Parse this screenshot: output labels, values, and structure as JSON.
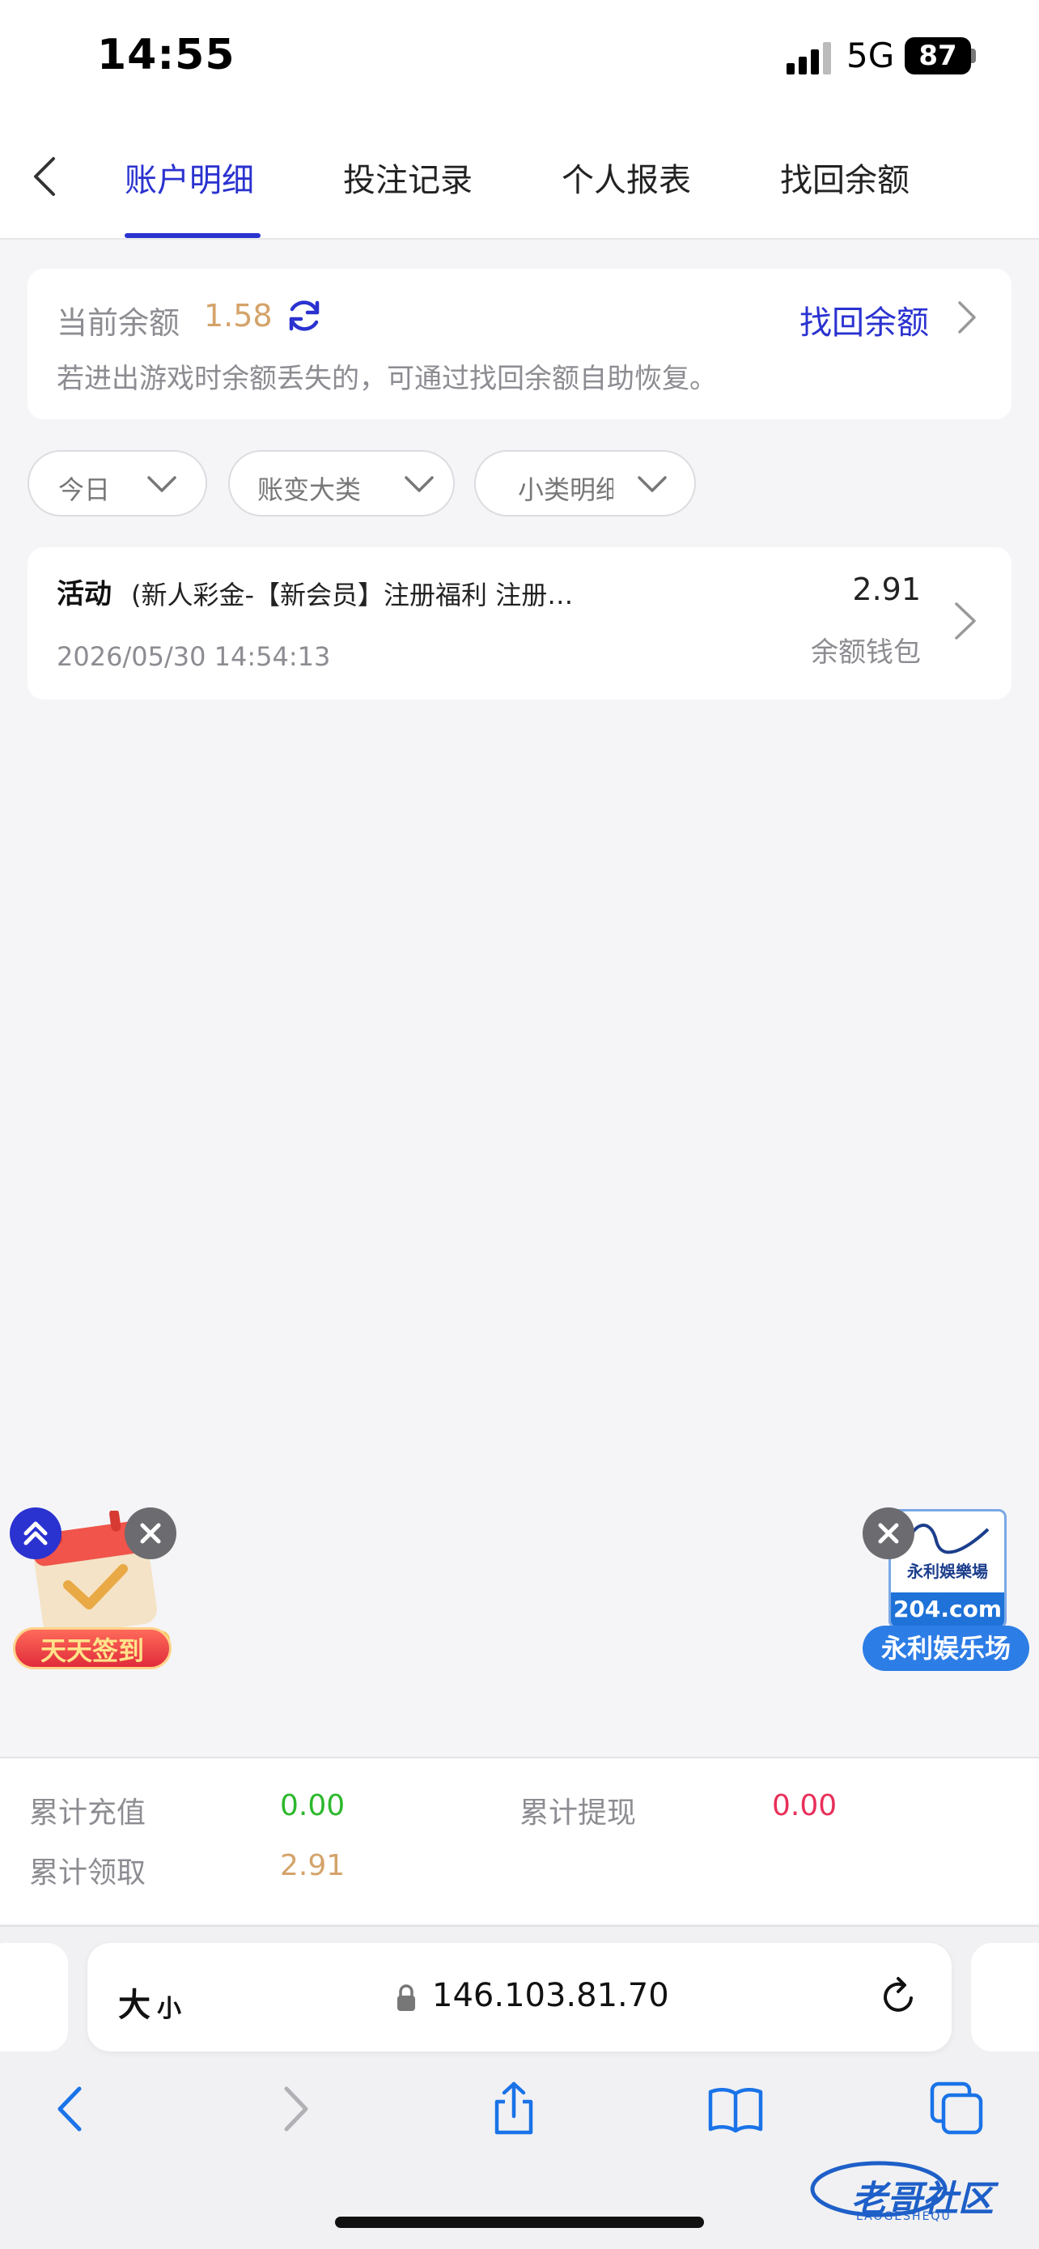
{
  "status_bar": {
    "time": "14:55",
    "network": "5G",
    "battery": "87"
  },
  "tabs": [
    {
      "label": "账户明细",
      "active": true
    },
    {
      "label": "投注记录",
      "active": false
    },
    {
      "label": "个人报表",
      "active": false
    },
    {
      "label": "找回余额",
      "active": false
    }
  ],
  "balance": {
    "label": "当前余额",
    "value": "1.58",
    "recover_link": "找回余额",
    "hint": "若进出游戏时余额丢失的，可通过找回余额自助恢复。"
  },
  "filters": [
    {
      "label": "今日"
    },
    {
      "label": "账变大类"
    },
    {
      "label": "小类明细"
    }
  ],
  "records": [
    {
      "type": "活动",
      "description": "(新人彩金-【新会员】注册福利 注册…",
      "time": "2026/05/30 14:54:13",
      "amount": "2.91",
      "wallet": "余额钱包"
    }
  ],
  "floating": {
    "signin_label": "天天签到",
    "promo_domain": "204.com",
    "promo_logo_text": "永利娛樂場",
    "promo_label": "永利娱乐场"
  },
  "totals": {
    "recharge_label": "累计充值",
    "recharge_value": "0.00",
    "withdraw_label": "累计提现",
    "withdraw_value": "0.00",
    "claimed_label": "累计领取",
    "claimed_value": "2.91"
  },
  "browser": {
    "text_size_big": "大",
    "text_size_small": "小",
    "url": "146.103.81.70"
  },
  "watermark": {
    "text": "老哥社区",
    "sub": "LAOGESHEQU"
  },
  "colors": {
    "accent": "#2a32d0",
    "balance": "#d4a36a",
    "positive": "#2db82d",
    "negative": "#e8305a"
  },
  "icons": [
    "back-chevron-icon",
    "refresh-icon",
    "chevron-right-icon",
    "chevron-down-icon",
    "close-icon",
    "double-up-icon",
    "lock-icon",
    "reload-icon",
    "browser-back-icon",
    "browser-forward-icon",
    "share-icon",
    "bookmarks-icon",
    "tabs-icon"
  ]
}
